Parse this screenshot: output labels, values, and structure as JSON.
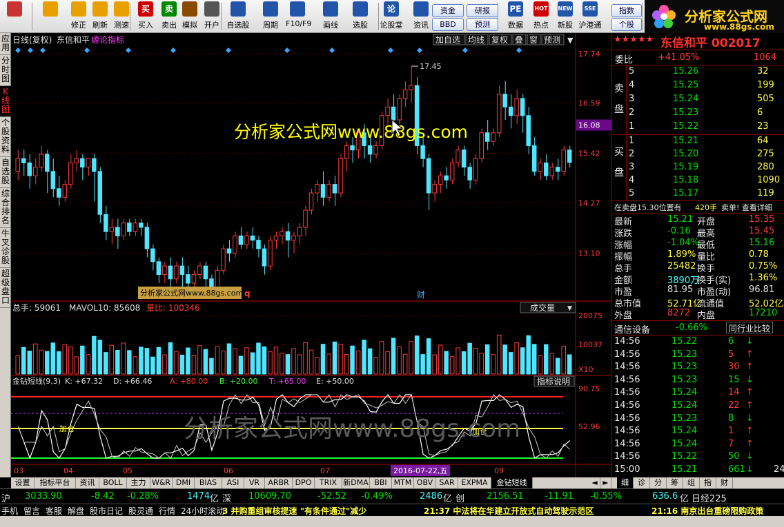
{
  "toolbar": {
    "buttons": [
      {
        "label": "",
        "icon": "grid-icon",
        "color": "#cc3333"
      },
      {
        "label": "",
        "icon": "back-arrow-icon",
        "color": "#e8a000"
      },
      {
        "label": "修正",
        "icon": "up-down-arrow-icon",
        "color": "#e8a000"
      },
      {
        "label": "刷新",
        "icon": "refresh-icon",
        "color": "#e8a000"
      },
      {
        "label": "测速",
        "icon": "clock-icon",
        "color": "#e8a000"
      },
      {
        "label": "买入",
        "icon": "buy-icon",
        "glyph": "买",
        "color": "#cc0000"
      },
      {
        "label": "卖出",
        "icon": "sell-icon",
        "glyph": "卖",
        "color": "#008800"
      },
      {
        "label": "模拟",
        "icon": "hammer-icon",
        "color": "#8a4a00"
      },
      {
        "label": "开户",
        "icon": "lock-icon",
        "color": "#555555"
      },
      {
        "label": "自选股",
        "icon": "star-folder-icon",
        "color": "#2255aa"
      },
      {
        "label": "周期",
        "icon": "calendar-icon",
        "color": "#2255aa"
      },
      {
        "label": "F10/F9",
        "icon": "f10-icon",
        "color": "#2255aa"
      },
      {
        "label": "画线",
        "icon": "pen-icon",
        "color": "#2255aa"
      },
      {
        "label": "选股",
        "icon": "chart-icon",
        "color": "#2255aa"
      },
      {
        "label": "论股堂",
        "icon": "speech-icon",
        "glyph": "论",
        "color": "#2255aa"
      },
      {
        "label": "资讯",
        "icon": "news-icon",
        "color": "#2255aa"
      },
      {
        "label": "数据",
        "icon": "pe-icon",
        "glyph": "PE",
        "color": "#2255aa"
      },
      {
        "label": "热点",
        "icon": "hot-icon",
        "glyph": "HOT",
        "color": "#cc0000"
      },
      {
        "label": "新股",
        "icon": "new-icon",
        "glyph": "NEW",
        "color": "#2255aa"
      },
      {
        "label": "沪港通",
        "icon": "hk-connect-icon",
        "glyph": "SSE",
        "color": "#2255aa"
      }
    ],
    "boxes": {
      "capital": "资金",
      "research": "研报",
      "bbd": "BBD",
      "forecast": "预测",
      "index": "指数",
      "stock": "个股"
    }
  },
  "logo": {
    "title": "分析家公式网",
    "url": "www.88gs.com"
  },
  "left_tabs": [
    "应用",
    "分时图",
    "K线图",
    "个股资料",
    "自选股",
    "综合排名",
    "牛叉诊股",
    "超级盘口"
  ],
  "chart": {
    "header": {
      "period": "日线(复权)",
      "stock": "东信和平",
      "indicator": "缠论指标"
    },
    "top_buttons": [
      "加自选",
      "均线",
      "复权",
      "叠",
      "窗",
      "预测"
    ],
    "price_ticks": [
      "17.74",
      "16.59",
      "15.42",
      "14.27",
      "13.10"
    ],
    "highlight_price": "16.08",
    "high_label": "17.45",
    "low_label": "12.22",
    "watermark_center": "分析家公式网www.88gs.com",
    "watermark_small": "分析家公式网www.88gs.com",
    "q_marker": "q",
    "cai_marker": "财",
    "volume": {
      "total_label": "总手: 59061",
      "mavol_label": "MAVOL10: 85608",
      "ratio_label": "量比: 100346",
      "dropdown": "成交量",
      "ticks": [
        "20075",
        "10037"
      ],
      "unit": "X10"
    },
    "osc": {
      "name": "金钻短线(9,3)",
      "k": "K: +67.32",
      "d": "D: +66.46",
      "a": "A: +80.00",
      "b": "B: +20.00",
      "t": "T: +65.00",
      "e": "E: +50.00",
      "help": "指标说明",
      "ticks": [
        "90.75",
        "52.96"
      ],
      "watermark": "分析家公式网www.88gs.com",
      "add_labels": [
        "加仓",
        "加仓"
      ]
    },
    "x_labels": [
      "03",
      "04",
      "05",
      "06",
      "07",
      "08",
      "09"
    ],
    "date_marker": "2016-07-22,五"
  },
  "chart_data": {
    "type": "candlestick",
    "title": "东信和平 日线(复权)",
    "y_range": [
      12.0,
      17.9
    ],
    "candles": [
      [
        15.0,
        15.5,
        15.3,
        14.8
      ],
      [
        15.3,
        15.5,
        15.2,
        14.9
      ],
      [
        15.2,
        15.4,
        14.9,
        14.6
      ],
      [
        14.9,
        15.3,
        15.1,
        14.7
      ],
      [
        15.1,
        15.6,
        15.4,
        15.0
      ],
      [
        15.4,
        15.5,
        15.0,
        14.5
      ],
      [
        15.0,
        15.3,
        14.6,
        14.4
      ],
      [
        14.6,
        14.9,
        14.4,
        14.2
      ],
      [
        14.4,
        14.8,
        14.7,
        14.3
      ],
      [
        14.7,
        15.4,
        15.2,
        14.6
      ],
      [
        15.2,
        15.5,
        15.3,
        15.0
      ],
      [
        15.3,
        15.4,
        15.1,
        14.8
      ],
      [
        15.1,
        15.3,
        15.3,
        14.9
      ],
      [
        15.3,
        15.4,
        15.0,
        14.3
      ],
      [
        15.0,
        15.1,
        14.0,
        13.8
      ],
      [
        14.0,
        14.2,
        13.6,
        13.4
      ],
      [
        13.6,
        13.9,
        13.7,
        13.3
      ],
      [
        13.7,
        13.9,
        13.5,
        13.2
      ],
      [
        13.5,
        13.9,
        13.8,
        13.4
      ],
      [
        13.8,
        13.9,
        13.6,
        13.5
      ],
      [
        13.6,
        13.9,
        13.8,
        13.5
      ],
      [
        13.8,
        13.9,
        13.7,
        13.5
      ],
      [
        13.7,
        13.8,
        13.2,
        13.0
      ],
      [
        13.2,
        13.3,
        12.9,
        12.7
      ],
      [
        12.9,
        13.0,
        12.6,
        12.4
      ],
      [
        12.6,
        12.9,
        12.8,
        12.4
      ],
      [
        12.8,
        13.0,
        12.5,
        12.3
      ],
      [
        12.5,
        12.9,
        12.8,
        12.4
      ],
      [
        12.8,
        13.0,
        12.6,
        12.3
      ],
      [
        12.6,
        12.8,
        12.4,
        12.3
      ],
      [
        12.4,
        12.7,
        12.6,
        12.3
      ],
      [
        12.6,
        12.9,
        12.8,
        12.5
      ],
      [
        12.8,
        12.9,
        12.5,
        12.3
      ],
      [
        12.5,
        12.6,
        12.3,
        12.22
      ],
      [
        12.3,
        12.8,
        12.7,
        12.25
      ],
      [
        12.7,
        13.3,
        13.2,
        12.6
      ],
      [
        13.2,
        13.4,
        13.1,
        12.9
      ],
      [
        13.1,
        13.6,
        13.5,
        13.0
      ],
      [
        13.5,
        13.7,
        13.3,
        13.2
      ],
      [
        13.3,
        13.6,
        13.5,
        13.2
      ],
      [
        13.5,
        13.7,
        13.4,
        13.2
      ],
      [
        13.4,
        13.5,
        13.2,
        13.0
      ],
      [
        13.2,
        13.3,
        12.8,
        12.6
      ],
      [
        12.8,
        13.5,
        13.4,
        12.7
      ],
      [
        13.4,
        13.6,
        13.5,
        13.2
      ],
      [
        13.5,
        13.7,
        13.6,
        13.3
      ],
      [
        13.6,
        13.8,
        13.4,
        13.0
      ],
      [
        13.4,
        13.6,
        13.5,
        13.1
      ],
      [
        13.5,
        13.8,
        13.7,
        13.3
      ],
      [
        13.7,
        14.2,
        14.1,
        13.5
      ],
      [
        14.1,
        14.6,
        14.5,
        14.0
      ],
      [
        14.5,
        14.8,
        14.7,
        14.3
      ],
      [
        14.7,
        15.0,
        14.4,
        14.2
      ],
      [
        14.4,
        14.8,
        14.7,
        14.3
      ],
      [
        14.7,
        14.9,
        14.5,
        14.2
      ],
      [
        14.5,
        15.4,
        15.3,
        14.4
      ],
      [
        15.3,
        15.7,
        15.6,
        15.0
      ],
      [
        15.6,
        15.8,
        15.5,
        15.2
      ],
      [
        15.5,
        16.0,
        15.9,
        15.3
      ],
      [
        15.9,
        16.1,
        15.6,
        15.3
      ],
      [
        15.6,
        15.8,
        15.4,
        15.2
      ],
      [
        15.4,
        15.7,
        15.6,
        15.3
      ],
      [
        15.6,
        16.4,
        16.3,
        15.5
      ],
      [
        16.3,
        16.7,
        16.5,
        16.1
      ],
      [
        16.5,
        16.8,
        16.2,
        15.9
      ],
      [
        16.2,
        16.8,
        16.7,
        16.1
      ],
      [
        16.7,
        17.1,
        16.9,
        16.5
      ],
      [
        16.9,
        17.45,
        17.0,
        16.6
      ],
      [
        17.0,
        17.2,
        15.6,
        15.4
      ],
      [
        15.6,
        15.9,
        15.3,
        15.1
      ],
      [
        15.3,
        15.4,
        14.5,
        14.1
      ],
      [
        14.5,
        14.8,
        14.7,
        14.3
      ],
      [
        14.7,
        15.0,
        14.9,
        14.5
      ],
      [
        14.9,
        15.1,
        14.8,
        14.6
      ],
      [
        14.8,
        15.3,
        15.2,
        14.7
      ],
      [
        15.2,
        15.6,
        15.5,
        15.1
      ],
      [
        15.5,
        15.6,
        15.1,
        14.9
      ],
      [
        15.1,
        15.2,
        14.8,
        14.6
      ],
      [
        14.8,
        15.4,
        15.3,
        14.7
      ],
      [
        15.3,
        16.0,
        15.9,
        15.2
      ],
      [
        15.9,
        16.2,
        15.7,
        15.5
      ],
      [
        15.7,
        16.0,
        15.9,
        15.6
      ],
      [
        15.9,
        17.0,
        16.8,
        15.8
      ],
      [
        16.8,
        17.1,
        16.5,
        16.2
      ],
      [
        16.5,
        16.8,
        16.3,
        16.0
      ],
      [
        16.3,
        16.9,
        16.7,
        16.1
      ],
      [
        16.7,
        16.8,
        16.3,
        15.9
      ],
      [
        16.3,
        16.5,
        15.6,
        15.4
      ],
      [
        15.6,
        15.8,
        15.0,
        14.9
      ],
      [
        15.0,
        15.3,
        15.2,
        14.8
      ],
      [
        15.2,
        15.4,
        14.9,
        14.8
      ],
      [
        14.9,
        15.2,
        15.1,
        14.8
      ],
      [
        15.1,
        15.3,
        15.0,
        14.8
      ],
      [
        15.0,
        15.6,
        15.5,
        14.9
      ],
      [
        15.5,
        15.6,
        15.21,
        15.1
      ]
    ]
  },
  "right_panel": {
    "stars": "★★★★★",
    "title": "东信和平 002017",
    "weibi_label": "委比",
    "weibi_value": "+41.05%",
    "weibi_amount": "1064",
    "sell_label": "卖盘",
    "buy_label": "买盘",
    "sell": [
      {
        "n": "5",
        "price": "15.26",
        "vol": "32"
      },
      {
        "n": "4",
        "price": "15.25",
        "vol": "199"
      },
      {
        "n": "3",
        "price": "15.24",
        "vol": "505"
      },
      {
        "n": "2",
        "price": "15.23",
        "vol": "6"
      },
      {
        "n": "1",
        "price": "15.22",
        "vol": "23"
      }
    ],
    "buy": [
      {
        "n": "1",
        "price": "15.21",
        "vol": "64"
      },
      {
        "n": "2",
        "price": "15.20",
        "vol": "275"
      },
      {
        "n": "3",
        "price": "15.19",
        "vol": "280"
      },
      {
        "n": "4",
        "price": "15.18",
        "vol": "1090"
      },
      {
        "n": "5",
        "price": "15.17",
        "vol": "119"
      }
    ],
    "note_left": "在卖盘15.30位置有",
    "note_vol": "420手",
    "note_right": "卖单! 查看详细",
    "quote": [
      {
        "l1": "最新",
        "v1": "15.21",
        "c1": "green",
        "l2": "开盘",
        "v2": "15.35",
        "c2": "red"
      },
      {
        "l1": "涨跌",
        "v1": "-0.16",
        "c1": "green",
        "l2": "最高",
        "v2": "15.45",
        "c2": "red"
      },
      {
        "l1": "涨幅",
        "v1": "-1.04%",
        "c1": "green",
        "l2": "最低",
        "v2": "15.16",
        "c2": "green"
      },
      {
        "l1": "振幅",
        "v1": "1.89%",
        "c1": "yel",
        "l2": "量比",
        "v2": "0.78",
        "c2": "yel"
      },
      {
        "l1": "总手",
        "v1": "25482",
        "c1": "yel",
        "l2": "换手",
        "v2": "0.75%",
        "c2": "yel"
      },
      {
        "l1": "金额",
        "v1": "3890万",
        "c1": "cyan",
        "l2": "换手(实)",
        "v2": "1.36%",
        "c2": "yel"
      },
      {
        "l1": "市盈",
        "v1": "81.95",
        "c1": "white",
        "l2": "市盈(动)",
        "v2": "96.81",
        "c2": "white"
      },
      {
        "l1": "总市值",
        "v1": "52.71亿",
        "c1": "yel",
        "l2": "流通值",
        "v2": "52.02亿",
        "c2": "yel"
      },
      {
        "l1": "外盘",
        "v1": "8272",
        "c1": "red",
        "l2": "内盘",
        "v2": "17210",
        "c2": "green"
      }
    ],
    "industry_name": "通信设备",
    "industry_pct": "-0.66%",
    "industry_btn": "同行业比较",
    "ticks": [
      {
        "t": "14:56",
        "p": "15.22",
        "v": "6",
        "up": false
      },
      {
        "t": "14:56",
        "p": "15.23",
        "v": "5",
        "up": true
      },
      {
        "t": "14:56",
        "p": "15.23",
        "v": "30",
        "up": true
      },
      {
        "t": "14:56",
        "p": "15.23",
        "v": "15",
        "up": false
      },
      {
        "t": "14:56",
        "p": "15.24",
        "v": "14",
        "up": true
      },
      {
        "t": "14:56",
        "p": "15.24",
        "v": "22",
        "up": true
      },
      {
        "t": "14:56",
        "p": "15.23",
        "v": "8",
        "up": false
      },
      {
        "t": "14:56",
        "p": "15.24",
        "v": "1",
        "up": true
      },
      {
        "t": "14:56",
        "p": "15.24",
        "v": "7",
        "up": true
      },
      {
        "t": "14:56",
        "p": "15.22",
        "v": "50",
        "up": false
      },
      {
        "t": "15:00",
        "p": "15.21",
        "v": "661",
        "up": false,
        "extra": "24"
      }
    ]
  },
  "bottom_tabs": [
    "设置",
    "指标平台",
    "资讯",
    "BOLL",
    "主力",
    "W&R",
    "DMI",
    "BIAS",
    "ASI",
    "VR",
    "ARBR",
    "DPO",
    "TRIX",
    "新DMA",
    "BBI",
    "MTM",
    "OBV",
    "SAR",
    "EXPMA",
    "金钻短线"
  ],
  "right_tabs": [
    "细",
    "诊",
    "分",
    "筹",
    "组",
    "指",
    "财"
  ],
  "index_bar": {
    "sh_label": "沪",
    "sh_val": "3033.90",
    "sh_chg": "-8.42",
    "sh_pct": "-0.28%",
    "sh_amt": "1474",
    "sh_unit": "亿",
    "sz_label": "深",
    "sz_val": "10609.70",
    "sz_chg": "-52.52",
    "sz_pct": "-0.49%",
    "sz_amt": "2486",
    "sz_unit": "亿",
    "cy_label": "创",
    "cy_val": "2156.51",
    "cy_chg": "-11.91",
    "cy_pct": "-0.55%",
    "cy_amt": "636.6",
    "cy_unit": "亿",
    "last_label": "日经225"
  },
  "news_bar": {
    "items": [
      "手机",
      "留言",
      "客服",
      "解盘",
      "股市日记",
      "股灵通",
      "行情",
      "24小时滚动"
    ],
    "headline1": "3 并购重组审核提速 \"有条件通过\"减少",
    "headline2": "21:37 中法将在华建立开放式自动驾驶示范区",
    "headline3": "21:16 南京出台重磅限购政策"
  }
}
